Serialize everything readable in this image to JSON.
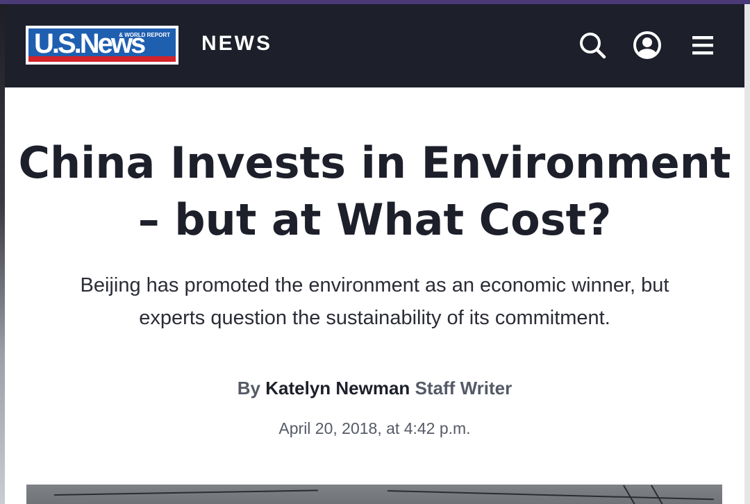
{
  "header": {
    "logo": {
      "main_text": "U.S.News",
      "sub_text": "& WORLD REPORT"
    },
    "section_label": "NEWS",
    "icons": {
      "search": "search-icon",
      "account": "user-account-icon",
      "menu": "hamburger-menu-icon"
    }
  },
  "article": {
    "headline_line1": "China Invests in Environment",
    "headline_line2": "– but at What Cost?",
    "dek_line1": "Beijing has promoted the environment as an economic winner, but",
    "dek_line2": "experts question the sustainability of its commitment.",
    "byline": {
      "prefix": "By",
      "author": "Katelyn Newman",
      "role": "Staff Writer"
    },
    "date": "April 20, 2018, at 4:42 p.m."
  },
  "colors": {
    "header_bg": "#1d1f2a",
    "logo_blue": "#1f5fb0",
    "logo_red": "#d2232a",
    "headline": "#1d1f2a",
    "meta_gray": "#555a66"
  }
}
